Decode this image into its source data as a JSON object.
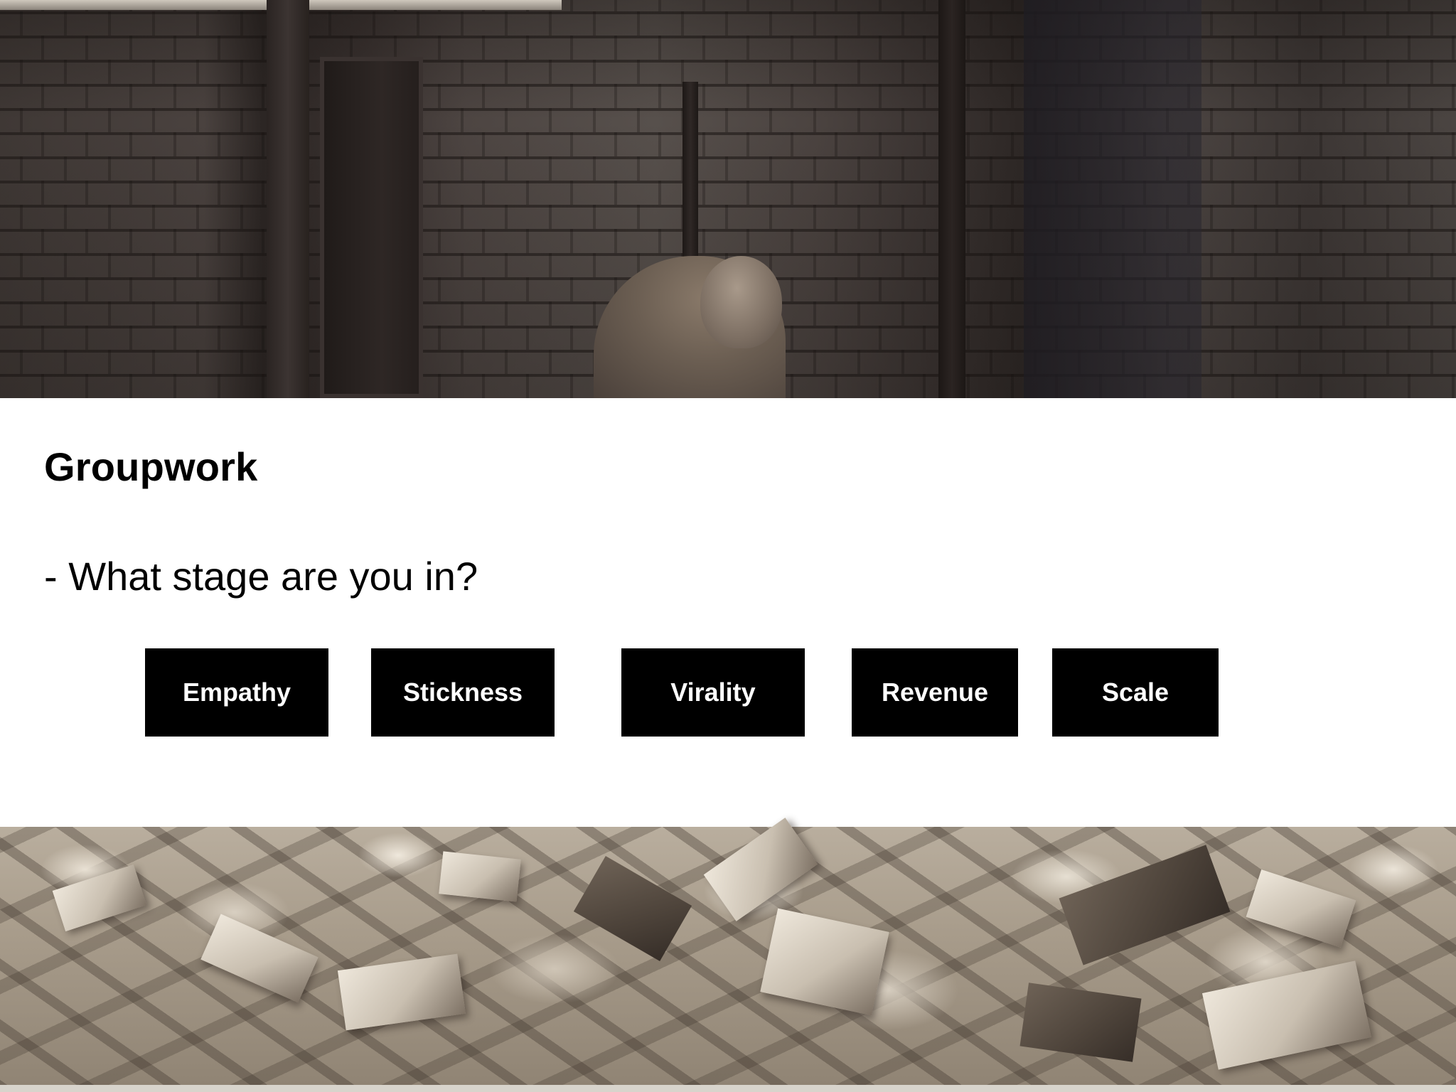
{
  "slide": {
    "title": "Groupwork",
    "question": "- What stage are you in?",
    "stages": [
      {
        "label": "Empathy"
      },
      {
        "label": "Stickness"
      },
      {
        "label": "Virality"
      },
      {
        "label": "Revenue"
      },
      {
        "label": "Scale"
      }
    ]
  },
  "colors": {
    "background": "#ffffff",
    "button_background": "#000000",
    "button_text": "#ffffff",
    "text": "#000000"
  }
}
